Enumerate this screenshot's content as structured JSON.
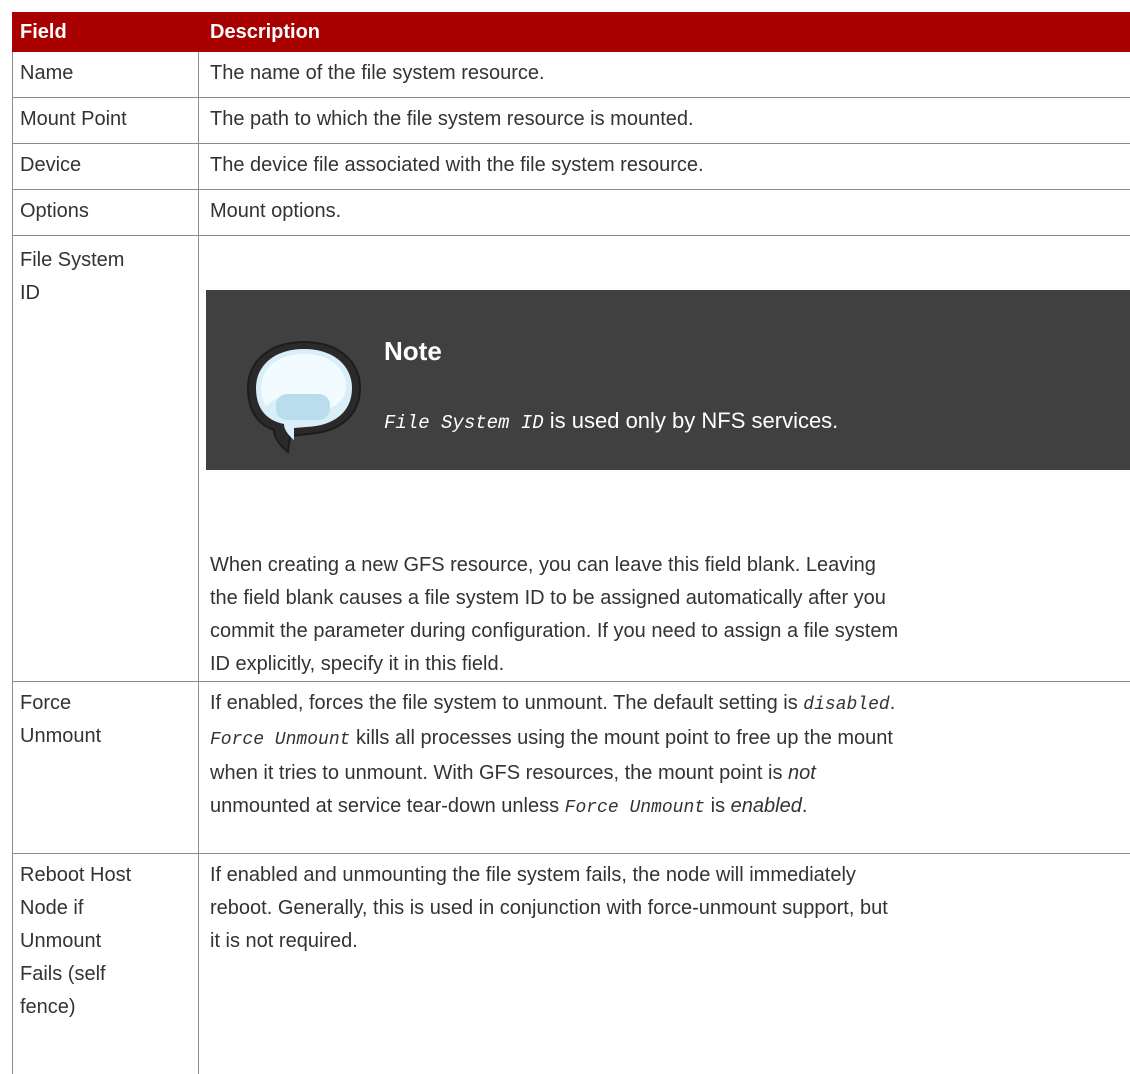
{
  "header": {
    "field": "Field",
    "description": "Description"
  },
  "rows": [
    {
      "field": "Name",
      "description": "The name of the file system resource."
    },
    {
      "field": "Mount Point",
      "description": "The path to which the file system resource is mounted."
    },
    {
      "field": "Device",
      "description": "The device file associated with the file system resource."
    },
    {
      "field": "Options",
      "description": "Mount options."
    },
    {
      "field_line1": "File System",
      "field_line2": "ID",
      "note_title": "Note",
      "note_code": "File System ID",
      "note_text": " is used only by NFS services.",
      "para_lines": [
        "When creating a new GFS resource, you can leave this field blank. Leaving",
        "the field blank causes a file system ID to be assigned automatically after you",
        "commit the parameter during configuration. If you need to assign a file system",
        "ID explicitly, specify it in this field."
      ]
    },
    {
      "field_line1": "Force",
      "field_line2": "Unmount",
      "l1a": "If enabled, forces the file system to unmount. The default setting is ",
      "l1code": "disabled",
      "l1b": ".",
      "l2code": "Force Unmount",
      "l2b": " kills all processes using the mount point to free up the mount",
      "l3a": "when it tries to unmount. With GFS resources, the mount point is ",
      "l3em": "not",
      "l4a": "unmounted at service tear-down unless ",
      "l4code": "Force Unmount",
      "l4b": " is ",
      "l4em": "enabled",
      "l4c": "."
    },
    {
      "field_lines": [
        "Reboot Host",
        "Node if",
        "Unmount",
        "Fails (self",
        "fence)"
      ],
      "desc_lines": [
        "If enabled and unmounting the file system fails, the node will immediately",
        "reboot. Generally, this is used in conjunction with force-unmount support, but",
        "it is not required."
      ]
    }
  ],
  "colors": {
    "header_bg": "#a80000",
    "note_bg": "#404040",
    "border": "#8c8c8c"
  }
}
